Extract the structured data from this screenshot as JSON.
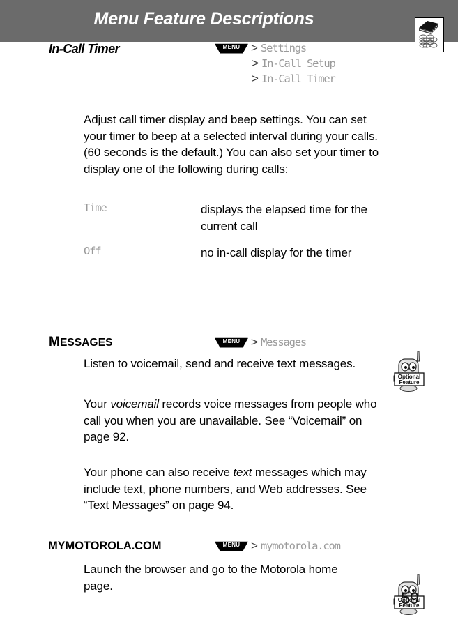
{
  "header": {
    "title": "Menu Feature Descriptions",
    "icon": "book-mesh-icon",
    "bar_color": "#6b6b6b",
    "title_color": "#ffffff"
  },
  "menu_key_label": "MENU",
  "separator": ">",
  "menu_text_color": "#9a9a9a",
  "sections": [
    {
      "id": "in-call-timer",
      "name": "In-Call Timer",
      "name_style": "bold-italic",
      "menu_path": [
        "Settings",
        "In-Call Setup",
        "In-Call Timer"
      ],
      "body": "Adjust call timer display and beep settings. You can set your timer to beep at a selected interval during your calls. (60 seconds is the default.) You can also set your timer to display one of the following during calls:",
      "definitions": [
        {
          "term": "Time",
          "desc": "displays the elapsed time for the current call"
        },
        {
          "term": "Off",
          "desc": "no in-call display for the timer"
        }
      ]
    },
    {
      "id": "messages",
      "name": "Messages",
      "name_first_letter": "M",
      "name_rest": "ESSAGES",
      "name_style": "small-caps",
      "menu_path": [
        "Messages"
      ],
      "paragraphs": [
        {
          "parts": [
            {
              "text": "Listen to voicemail, send and receive text messages.",
              "style": "normal"
            }
          ]
        },
        {
          "parts": [
            {
              "text": "Your ",
              "style": "normal"
            },
            {
              "text": "voicemail",
              "style": "italic"
            },
            {
              "text": " records voice messages from people who call you when you are unavailable. See “Voicemail” on page 92.",
              "style": "normal"
            }
          ]
        },
        {
          "parts": [
            {
              "text": "Your phone can also receive ",
              "style": "normal"
            },
            {
              "text": "text",
              "style": "italic"
            },
            {
              "text": " messages which may include text, phone numbers, and Web addresses. See “Text Messages” on page 94.",
              "style": "normal"
            }
          ]
        }
      ],
      "badge": {
        "icon": "optional-feature-mascot-icon",
        "line1": "Optional",
        "line2": "Feature"
      }
    },
    {
      "id": "mymotorola-com",
      "name": "MYMOTOROLA.COM",
      "name_style": "all-caps",
      "menu_path": [
        "mymotorola.com"
      ],
      "paragraphs": [
        {
          "parts": [
            {
              "text": "Launch the browser and go to the Motorola home page.",
              "style": "normal"
            }
          ]
        }
      ],
      "badge": {
        "icon": "optional-feature-mascot-icon",
        "line1": "Optional",
        "line2": "Feature"
      }
    }
  ],
  "page_number": "59"
}
